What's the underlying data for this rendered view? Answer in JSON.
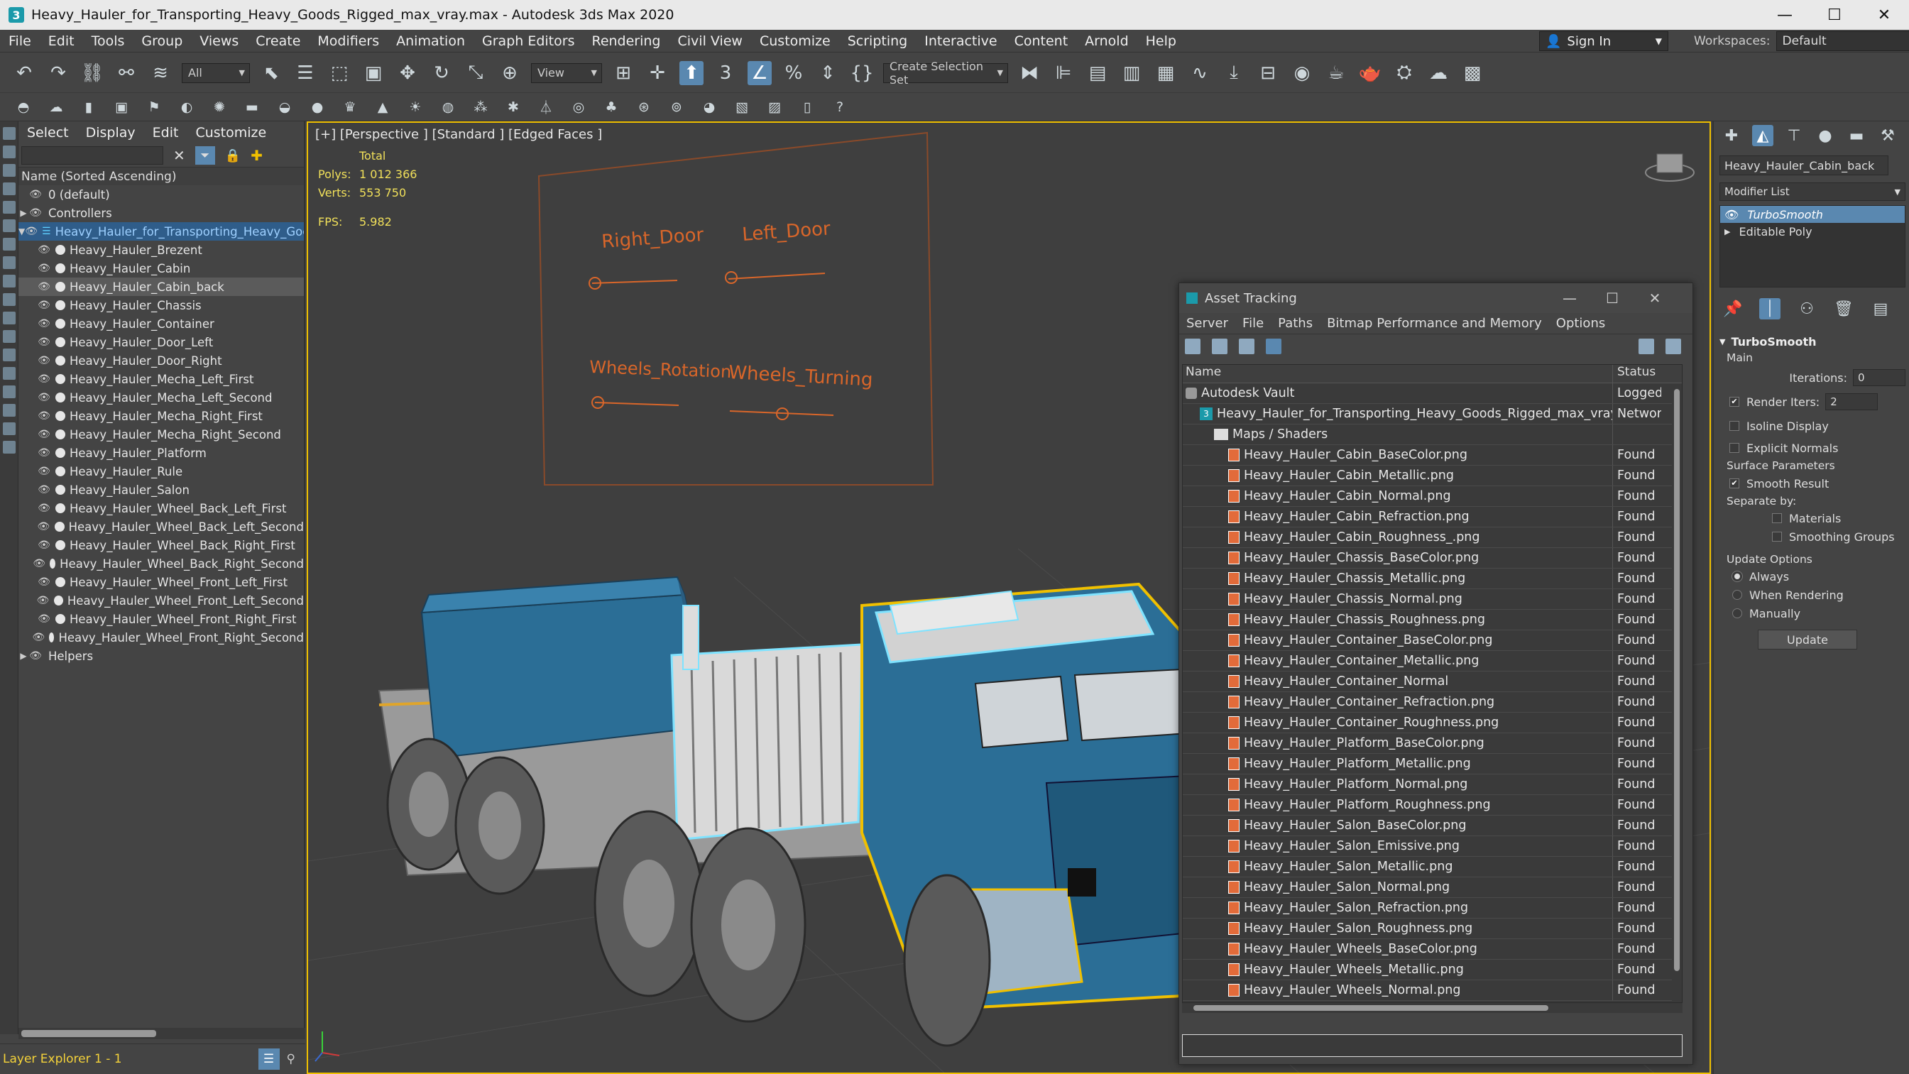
{
  "window": {
    "title": "Heavy_Hauler_for_Transporting_Heavy_Goods_Rigged_max_vray.max - Autodesk 3ds Max 2020",
    "app_icon": "3",
    "minimize": "—",
    "maximize": "☐",
    "close": "✕"
  },
  "menubar": {
    "items": [
      "File",
      "Edit",
      "Tools",
      "Group",
      "Views",
      "Create",
      "Modifiers",
      "Animation",
      "Graph Editors",
      "Rendering",
      "Civil View",
      "Customize",
      "Scripting",
      "Interactive",
      "Content",
      "Arnold",
      "Help"
    ],
    "signin": "Sign In",
    "workspaces_label": "Workspaces:",
    "workspace_value": "Default"
  },
  "toolbar": {
    "filter_value": "All",
    "view_value": "View",
    "selection_set": "Create Selection Set"
  },
  "scene_explorer": {
    "menus": [
      "Select",
      "Display",
      "Edit",
      "Customize"
    ],
    "column_header": "Name (Sorted Ascending)",
    "items": [
      {
        "label": "0 (default)",
        "level": 1,
        "expand": "",
        "kind": "layer"
      },
      {
        "label": "Controllers",
        "level": 1,
        "expand": "▶",
        "kind": "layer"
      },
      {
        "label": "Heavy_Hauler_for_Transporting_Heavy_Goods",
        "level": 1,
        "expand": "▼",
        "kind": "root"
      },
      {
        "label": "Heavy_Hauler_Brezent",
        "level": 2,
        "kind": "obj"
      },
      {
        "label": "Heavy_Hauler_Cabin",
        "level": 2,
        "kind": "obj"
      },
      {
        "label": "Heavy_Hauler_Cabin_back",
        "level": 2,
        "kind": "obj",
        "selected": true
      },
      {
        "label": "Heavy_Hauler_Chassis",
        "level": 2,
        "kind": "obj"
      },
      {
        "label": "Heavy_Hauler_Container",
        "level": 2,
        "kind": "obj"
      },
      {
        "label": "Heavy_Hauler_Door_Left",
        "level": 2,
        "kind": "obj"
      },
      {
        "label": "Heavy_Hauler_Door_Right",
        "level": 2,
        "kind": "obj"
      },
      {
        "label": "Heavy_Hauler_Mecha_Left_First",
        "level": 2,
        "kind": "obj"
      },
      {
        "label": "Heavy_Hauler_Mecha_Left_Second",
        "level": 2,
        "kind": "obj"
      },
      {
        "label": "Heavy_Hauler_Mecha_Right_First",
        "level": 2,
        "kind": "obj"
      },
      {
        "label": "Heavy_Hauler_Mecha_Right_Second",
        "level": 2,
        "kind": "obj"
      },
      {
        "label": "Heavy_Hauler_Platform",
        "level": 2,
        "kind": "obj"
      },
      {
        "label": "Heavy_Hauler_Rule",
        "level": 2,
        "kind": "obj"
      },
      {
        "label": "Heavy_Hauler_Salon",
        "level": 2,
        "kind": "obj"
      },
      {
        "label": "Heavy_Hauler_Wheel_Back_Left_First",
        "level": 2,
        "kind": "obj"
      },
      {
        "label": "Heavy_Hauler_Wheel_Back_Left_Second",
        "level": 2,
        "kind": "obj"
      },
      {
        "label": "Heavy_Hauler_Wheel_Back_Right_First",
        "level": 2,
        "kind": "obj"
      },
      {
        "label": "Heavy_Hauler_Wheel_Back_Right_Second",
        "level": 2,
        "kind": "obj"
      },
      {
        "label": "Heavy_Hauler_Wheel_Front_Left_First",
        "level": 2,
        "kind": "obj"
      },
      {
        "label": "Heavy_Hauler_Wheel_Front_Left_Second",
        "level": 2,
        "kind": "obj"
      },
      {
        "label": "Heavy_Hauler_Wheel_Front_Right_First",
        "level": 2,
        "kind": "obj"
      },
      {
        "label": "Heavy_Hauler_Wheel_Front_Right_Second",
        "level": 2,
        "kind": "obj"
      },
      {
        "label": "Helpers",
        "level": 1,
        "expand": "▶",
        "kind": "layer"
      }
    ],
    "status": "Layer Explorer 1 - 1"
  },
  "viewport": {
    "label": "[+] [Perspective ] [Standard ] [Edged Faces ]",
    "stats_total": "Total",
    "polys_label": "Polys:",
    "polys_value": "1 012 366",
    "verts_label": "Verts:",
    "verts_value": "553 750",
    "fps_label": "FPS:",
    "fps_value": "5.982",
    "rig_labels": [
      "Right_Door",
      "Left_Door",
      "Wheels_Rotation",
      "Wheels_Turning"
    ]
  },
  "asset_tracking": {
    "title": "Asset Tracking",
    "menus": [
      "Server",
      "File",
      "Paths",
      "Bitmap Performance and Memory",
      "Options"
    ],
    "col_name": "Name",
    "col_status": "Status",
    "rows": [
      {
        "name": "Autodesk Vault",
        "status": "Logged.",
        "indent": 0,
        "icon": "vault"
      },
      {
        "name": "Heavy_Hauler_for_Transporting_Heavy_Goods_Rigged_max_vray.max",
        "status": "Networ.",
        "indent": 1,
        "icon": "max"
      },
      {
        "name": "Maps / Shaders",
        "status": "",
        "indent": 2,
        "icon": "folder"
      },
      {
        "name": "Heavy_Hauler_Cabin_BaseColor.png",
        "status": "Found",
        "indent": 3,
        "icon": "file"
      },
      {
        "name": "Heavy_Hauler_Cabin_Metallic.png",
        "status": "Found",
        "indent": 3,
        "icon": "file"
      },
      {
        "name": "Heavy_Hauler_Cabin_Normal.png",
        "status": "Found",
        "indent": 3,
        "icon": "file"
      },
      {
        "name": "Heavy_Hauler_Cabin_Refraction.png",
        "status": "Found",
        "indent": 3,
        "icon": "file"
      },
      {
        "name": "Heavy_Hauler_Cabin_Roughness_.png",
        "status": "Found",
        "indent": 3,
        "icon": "file"
      },
      {
        "name": "Heavy_Hauler_Chassis_BaseColor.png",
        "status": "Found",
        "indent": 3,
        "icon": "file"
      },
      {
        "name": "Heavy_Hauler_Chassis_Metallic.png",
        "status": "Found",
        "indent": 3,
        "icon": "file"
      },
      {
        "name": "Heavy_Hauler_Chassis_Normal.png",
        "status": "Found",
        "indent": 3,
        "icon": "file"
      },
      {
        "name": "Heavy_Hauler_Chassis_Roughness.png",
        "status": "Found",
        "indent": 3,
        "icon": "file"
      },
      {
        "name": "Heavy_Hauler_Container_BaseColor.png",
        "status": "Found",
        "indent": 3,
        "icon": "file"
      },
      {
        "name": "Heavy_Hauler_Container_Metallic.png",
        "status": "Found",
        "indent": 3,
        "icon": "file"
      },
      {
        "name": "Heavy_Hauler_Container_Normal",
        "status": "Found",
        "indent": 3,
        "icon": "file"
      },
      {
        "name": "Heavy_Hauler_Container_Refraction.png",
        "status": "Found",
        "indent": 3,
        "icon": "file"
      },
      {
        "name": "Heavy_Hauler_Container_Roughness.png",
        "status": "Found",
        "indent": 3,
        "icon": "file"
      },
      {
        "name": "Heavy_Hauler_Platform_BaseColor.png",
        "status": "Found",
        "indent": 3,
        "icon": "file"
      },
      {
        "name": "Heavy_Hauler_Platform_Metallic.png",
        "status": "Found",
        "indent": 3,
        "icon": "file"
      },
      {
        "name": "Heavy_Hauler_Platform_Normal.png",
        "status": "Found",
        "indent": 3,
        "icon": "file"
      },
      {
        "name": "Heavy_Hauler_Platform_Roughness.png",
        "status": "Found",
        "indent": 3,
        "icon": "file"
      },
      {
        "name": "Heavy_Hauler_Salon_BaseColor.png",
        "status": "Found",
        "indent": 3,
        "icon": "file"
      },
      {
        "name": "Heavy_Hauler_Salon_Emissive.png",
        "status": "Found",
        "indent": 3,
        "icon": "file"
      },
      {
        "name": "Heavy_Hauler_Salon_Metallic.png",
        "status": "Found",
        "indent": 3,
        "icon": "file"
      },
      {
        "name": "Heavy_Hauler_Salon_Normal.png",
        "status": "Found",
        "indent": 3,
        "icon": "file"
      },
      {
        "name": "Heavy_Hauler_Salon_Refraction.png",
        "status": "Found",
        "indent": 3,
        "icon": "file"
      },
      {
        "name": "Heavy_Hauler_Salon_Roughness.png",
        "status": "Found",
        "indent": 3,
        "icon": "file"
      },
      {
        "name": "Heavy_Hauler_Wheels_BaseColor.png",
        "status": "Found",
        "indent": 3,
        "icon": "file"
      },
      {
        "name": "Heavy_Hauler_Wheels_Metallic.png",
        "status": "Found",
        "indent": 3,
        "icon": "file"
      },
      {
        "name": "Heavy_Hauler_Wheels_Normal.png",
        "status": "Found",
        "indent": 3,
        "icon": "file"
      }
    ]
  },
  "command_panel": {
    "object_name": "Heavy_Hauler_Cabin_back",
    "modifier_list": "Modifier List",
    "stack": [
      "TurboSmooth",
      "Editable Poly"
    ],
    "rollout_title": "TurboSmooth",
    "main": "Main",
    "iterations_label": "Iterations:",
    "iterations_value": "0",
    "render_iters_label": "Render Iters:",
    "render_iters_value": "2",
    "isoline": "Isoline Display",
    "explicit_normals": "Explicit Normals",
    "surface_params": "Surface Parameters",
    "smooth_result": "Smooth Result",
    "separate_by": "Separate by:",
    "materials": "Materials",
    "smoothing_groups": "Smoothing Groups",
    "update_options": "Update Options",
    "always": "Always",
    "when_rendering": "When Rendering",
    "manually": "Manually",
    "update": "Update"
  },
  "colors": {
    "selection_yellow": "#f0c000",
    "accent_blue": "#5a88b0",
    "truck_blue": "#2b6e96",
    "wire_cyan": "#7fe3ff",
    "rig_orange": "#d9662a"
  }
}
